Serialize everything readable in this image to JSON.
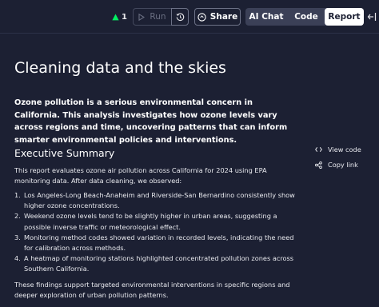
{
  "toolbar": {
    "warning_count": "1",
    "run_label": "Run",
    "share_label": "Share",
    "tabs": [
      "AI Chat",
      "Code",
      "Report"
    ],
    "active_tab": "Report"
  },
  "report": {
    "title": "Cleaning data and the skies",
    "intro": "Ozone pollution is a serious environmental concern in California. This analysis investigates how ozone levels vary across regions and time, uncovering patterns that can inform smarter environmental policies and interventions.",
    "section_title": "Executive Summary",
    "summary_intro": "This report evaluates ozone air pollution across California for 2024 using EPA monitoring data. After data cleaning, we observed:",
    "findings": [
      {
        "num": "1.",
        "text": "Los Angeles-Long Beach-Anaheim and Riverside-San Bernardino consistently show higher ozone concentrations."
      },
      {
        "num": "2.",
        "text": "Weekend ozone levels tend to be slightly higher in urban areas, suggesting a possible inverse traffic or meteorological effect."
      },
      {
        "num": "3.",
        "text": "Monitoring method codes showed variation in recorded levels, indicating the need for calibration across methods."
      },
      {
        "num": "4.",
        "text": "A heatmap of monitoring stations highlighted concentrated pollution zones across Southern California."
      }
    ],
    "conclusion": "These findings support targeted environmental interventions in specific regions and deeper exploration of urban pollution patterns."
  },
  "side_actions": {
    "view_code": "View code",
    "copy_link": "Copy link"
  },
  "colors": {
    "background": "#1c2033",
    "warning_green": "#03ef62",
    "active_tab_bg": "#ffffff"
  },
  "icons": [
    "warning-triangle-icon",
    "play-icon",
    "history-icon",
    "share-icon",
    "panel-collapse-icon",
    "code-icon",
    "link-icon"
  ]
}
